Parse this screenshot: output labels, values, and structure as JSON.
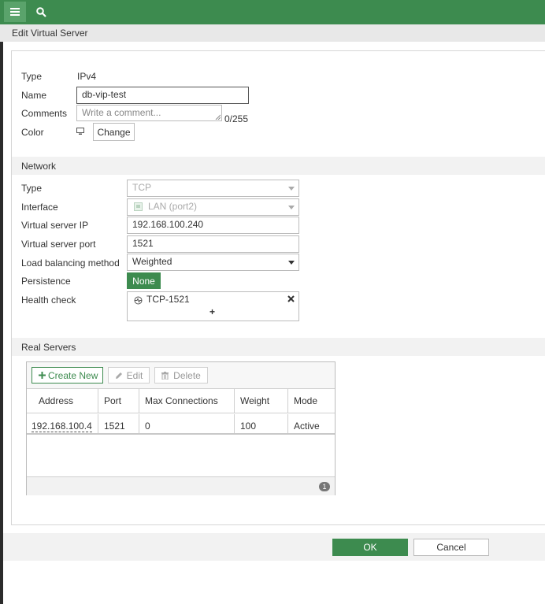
{
  "header": {
    "menu_icon": "hamburger-icon",
    "search_icon": "search-icon"
  },
  "dialog": {
    "title": "Edit Virtual Server"
  },
  "general": {
    "type_label": "Type",
    "type_value": "IPv4",
    "name_label": "Name",
    "name_value": "db-vip-test",
    "comments_label": "Comments",
    "comments_placeholder": "Write a comment...",
    "comments_counter": "0/255",
    "color_label": "Color",
    "change_label": "Change"
  },
  "network": {
    "section_title": "Network",
    "type_label": "Type",
    "type_value": "TCP",
    "interface_label": "Interface",
    "interface_value": "LAN (port2)",
    "vs_ip_label": "Virtual server IP",
    "vs_ip_value": "192.168.100.240",
    "vs_port_label": "Virtual server port",
    "vs_port_value": "1521",
    "lb_label": "Load balancing method",
    "lb_value": "Weighted",
    "persistence_label": "Persistence",
    "persistence_value": "None",
    "health_label": "Health check",
    "health_value": "TCP-1521",
    "health_add": "+"
  },
  "real_servers": {
    "section_title": "Real Servers",
    "create_new": "Create New",
    "edit": "Edit",
    "delete": "Delete",
    "columns": [
      "Address",
      "Port",
      "Max Connections",
      "Weight",
      "Mode"
    ],
    "rows": [
      [
        "192.168.100.4",
        "1521",
        "0",
        "100",
        "Active"
      ]
    ],
    "count": "1"
  },
  "footer": {
    "ok": "OK",
    "cancel": "Cancel"
  },
  "colors": {
    "accent": "#3d8b4f"
  }
}
